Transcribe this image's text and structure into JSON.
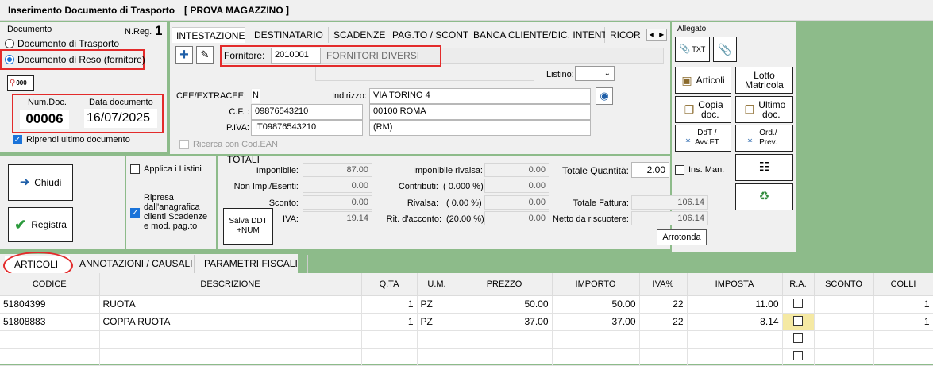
{
  "window": {
    "title": "Inserimento Documento di Trasporto",
    "subtitle": "[ PROVA MAGAZZINO ]"
  },
  "documento": {
    "group_label": "Documento",
    "nreg_label": "N.Reg.",
    "nreg_value": "1",
    "option_trasporto": "Documento di Trasporto",
    "option_reso": "Documento di Reso (fornitore)",
    "badge": "000",
    "num_doc_label": "Num.Doc.",
    "num_doc_value": "00006",
    "data_doc_label": "Data documento",
    "data_doc_value": "16/07/2025",
    "riprendi_label": "Riprendi ultimo documento"
  },
  "tabs": {
    "intestazione": "INTESTAZIONE",
    "destinatario": "DESTINATARIO",
    "scadenze": "SCADENZE",
    "pagto": "PAG.TO / SCONTI",
    "banca": "BANCA CLIENTE/DIC. INTENTO",
    "ricor": "RICOR"
  },
  "fornitore": {
    "label": "Fornitore:",
    "code": "2010001",
    "name": "FORNITORI DIVERSI",
    "listino_label": "Listino:",
    "cee_label": "CEE/EXTRACEE:",
    "cee_value": "N",
    "cf_label": "C.F. :",
    "cf_value": "09876543210",
    "piva_label": "P.IVA:",
    "piva_value": "IT09876543210",
    "indirizzo_label": "Indirizzo:",
    "indirizzo_value": "VIA TORINO 4",
    "citta_value": "00100 ROMA",
    "prov_value": "(RM)",
    "ricerca_ean": "Ricerca con Cod.EAN"
  },
  "allegato": {
    "label": "Allegato",
    "txt": "TXT",
    "articoli": "Articoli",
    "lotto": "Lotto Matricola",
    "copia": "Copia doc.",
    "ultimo": "Ultimo doc.",
    "ddt": "DdT / Avv.FT",
    "ord": "Ord./ Prev."
  },
  "actions": {
    "chiudi": "Chiudi",
    "registra": "Registra",
    "applica_listini": "Applica i Listini",
    "ripresa": "Ripresa dall'anagrafica clienti Scadenze e mod. pag.to",
    "salva_ddt": "Salva DDT +NUM"
  },
  "totali": {
    "title": "TOTALI",
    "imponibile_label": "Imponibile:",
    "imponibile": "87.00",
    "nonimp_label": "Non Imp./Esenti:",
    "nonimp": "0.00",
    "sconto_label": "Sconto:",
    "sconto": "0.00",
    "iva_label": "IVA:",
    "iva": "19.14",
    "imp_rivalsa_label": "Imponibile rivalsa:",
    "imp_rivalsa": "0.00",
    "contributi_label": "Contributi:",
    "contributi_pct": "( 0.000 %)",
    "contributi": "0.00",
    "rivalsa_label": "Rivalsa:",
    "rivalsa_pct": "( 0.00 %)",
    "rivalsa": "0.00",
    "rit_label": "Rit. d'acconto:",
    "rit_pct": "(20.00 %)",
    "rit": "0.00",
    "tot_qta_label": "Totale Quantità:",
    "tot_qta": "2.00",
    "ins_man": "Ins. Man.",
    "tot_fattura_label": "Totale Fattura:",
    "tot_fattura": "106.14",
    "netto_label": "Netto da riscuotere:",
    "netto": "106.14",
    "arrotonda": "Arrotonda"
  },
  "bottom_tabs": {
    "articoli": "ARTICOLI",
    "annotazioni": "ANNOTAZIONI  / CAUSALI",
    "parametri": "PARAMETRI FISCALI"
  },
  "grid": {
    "headers": [
      "CODICE",
      "DESCRIZIONE",
      "Q.TA",
      "U.M.",
      "PREZZO",
      "IMPORTO",
      "IVA%",
      "IMPOSTA",
      "R.A.",
      "SCONTO",
      "COLLI"
    ],
    "rows": [
      [
        "51804399",
        "RUOTA",
        "1",
        "PZ",
        "50.00",
        "50.00",
        "22",
        "11.00",
        "",
        "",
        "1"
      ],
      [
        "51808883",
        "COPPA RUOTA",
        "1",
        "PZ",
        "37.00",
        "37.00",
        "22",
        "8.14",
        "",
        "",
        "1"
      ]
    ]
  },
  "colors": {
    "background": "#8dbb8a",
    "highlight": "#e32b2b",
    "accent": "#1a73d9"
  }
}
